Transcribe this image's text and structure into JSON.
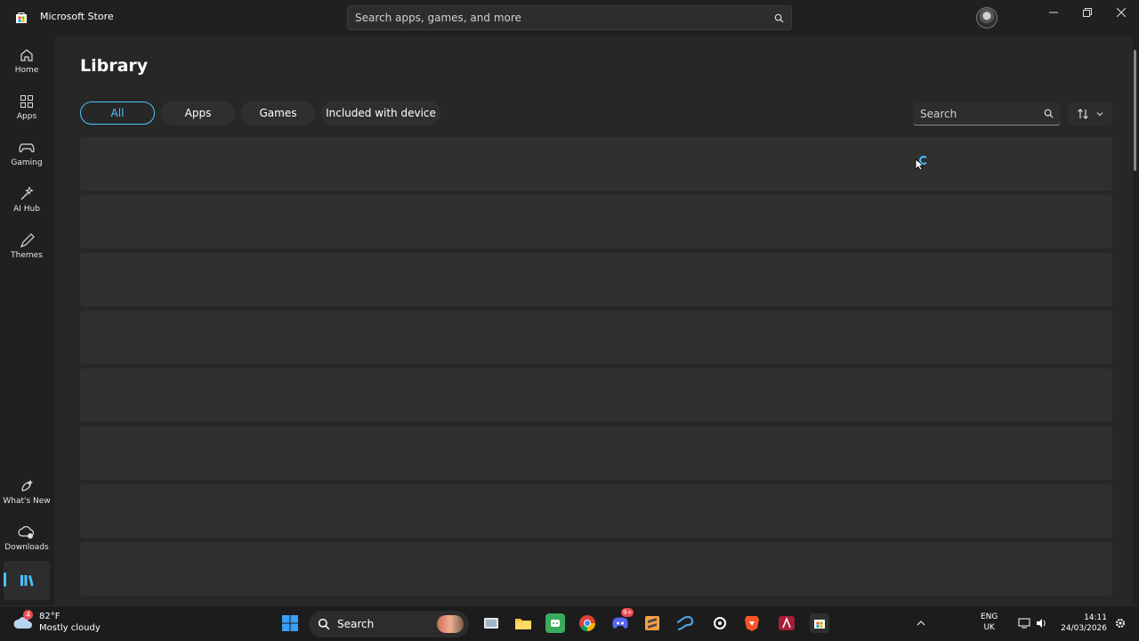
{
  "app": {
    "title": "Microsoft Store"
  },
  "header": {
    "search_placeholder": "Search apps, games, and more"
  },
  "sidebar": {
    "items": [
      {
        "label": "Home",
        "icon": "home-icon"
      },
      {
        "label": "Apps",
        "icon": "apps-icon"
      },
      {
        "label": "Gaming",
        "icon": "gaming-icon"
      },
      {
        "label": "AI Hub",
        "icon": "ai-hub-icon"
      },
      {
        "label": "Themes",
        "icon": "themes-icon"
      },
      {
        "label": "What's New",
        "icon": "whats-new-icon"
      },
      {
        "label": "Downloads",
        "icon": "downloads-icon"
      },
      {
        "label": "",
        "icon": "library-icon"
      }
    ]
  },
  "library": {
    "title": "Library",
    "filters": [
      "All",
      "Apps",
      "Games",
      "Included with device"
    ],
    "active_filter": "All",
    "search_placeholder": "Search"
  },
  "taskbar": {
    "weather_temp": "82°F",
    "weather_desc": "Mostly cloudy",
    "weather_badge": "4",
    "search_label": "Search",
    "discord_badge": "9+",
    "language": "ENG",
    "region": "UK",
    "time": "14:11",
    "date": "24/03/2026"
  },
  "colors": {
    "accent": "#4cc2ff",
    "background": "#202020",
    "content": "#272727",
    "skeleton": "#303030"
  }
}
